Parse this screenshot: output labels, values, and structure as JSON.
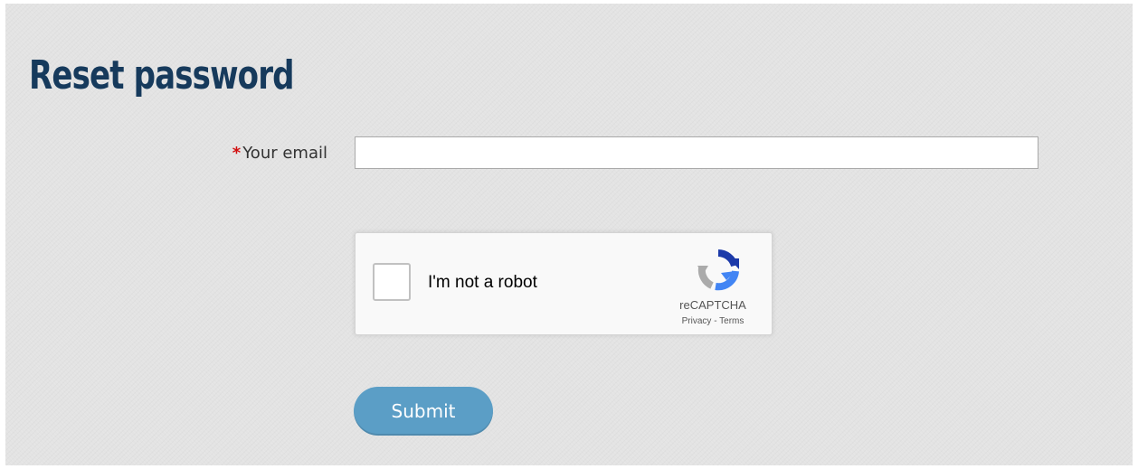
{
  "page": {
    "title": "Reset password"
  },
  "form": {
    "email_label": "Your email",
    "required_marker": "*",
    "email_value": "",
    "submit_label": "Submit"
  },
  "recaptcha": {
    "label": "I'm not a robot",
    "brand": "reCAPTCHA",
    "privacy_link": "Privacy",
    "separator": " - ",
    "terms_link": "Terms",
    "checked": false,
    "logo_icon": "recaptcha-logo-icon"
  },
  "colors": {
    "title": "#163a5c",
    "required": "#d20f0f",
    "submit_bg": "#5b9ec6",
    "background": "#e3e3e3"
  }
}
